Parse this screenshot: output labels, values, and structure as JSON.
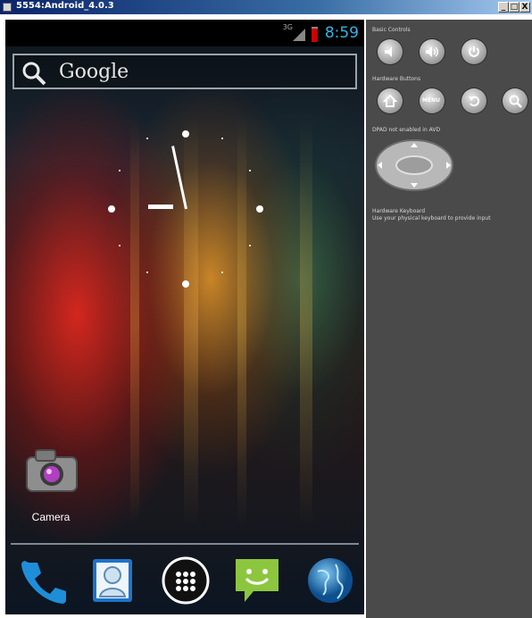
{
  "window": {
    "title": "5554:Android_4.0.3",
    "minimize_label": "_",
    "maximize_label": "□",
    "close_label": "X"
  },
  "status_bar": {
    "network": "3G",
    "time": "8:59"
  },
  "search_bar": {
    "label": "Google"
  },
  "home": {
    "camera_label": "Camera"
  },
  "dock": {
    "items": [
      "phone-icon",
      "contacts-icon",
      "app-drawer-icon",
      "messaging-icon",
      "browser-icon"
    ]
  },
  "controls": {
    "basic_controls_heading": "Basic Controls",
    "hardware_buttons_heading": "Hardware Buttons",
    "dpad_heading": "DPAD not enabled in AVD",
    "keyboard_heading": "Hardware Keyboard",
    "keyboard_text": "Use your physical keyboard to provide input",
    "menu_label": "MENU"
  },
  "colors": {
    "clock": "#33b5e5",
    "panel_bg": "#4a4a4a",
    "titlebar": "#0a246a"
  }
}
